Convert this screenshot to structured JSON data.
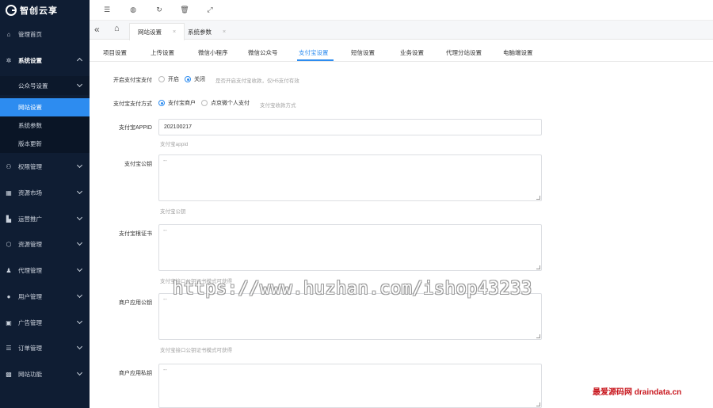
{
  "app": {
    "logo_text": "智创云享"
  },
  "sidebar": {
    "items": [
      {
        "label": "管理首页",
        "icon": "home-icon",
        "glyph": "⌂"
      },
      {
        "label": "系统设置",
        "icon": "gear-icon",
        "glyph": "✲"
      },
      {
        "label": "权限管理",
        "icon": "permission-icon",
        "glyph": "⚇"
      },
      {
        "label": "资源市场",
        "icon": "market-icon",
        "glyph": "▦"
      },
      {
        "label": "运营推广",
        "icon": "promotion-icon",
        "glyph": "▙"
      },
      {
        "label": "资源管理",
        "icon": "resource-icon",
        "glyph": "⬡"
      },
      {
        "label": "代理管理",
        "icon": "agent-icon",
        "glyph": "♟"
      },
      {
        "label": "用户管理",
        "icon": "user-icon",
        "glyph": "●"
      },
      {
        "label": "广告管理",
        "icon": "ad-icon",
        "glyph": "▣"
      },
      {
        "label": "订单管理",
        "icon": "order-icon",
        "glyph": "☰"
      },
      {
        "label": "网站功能",
        "icon": "site-function-icon",
        "glyph": "▩"
      }
    ],
    "subgroup": {
      "label": "公众号设置"
    },
    "subitems": [
      {
        "label": "网站设置"
      },
      {
        "label": "系统参数"
      },
      {
        "label": "版本更新"
      }
    ]
  },
  "toolbar": {
    "icons": [
      "collapse-icon",
      "globe-icon",
      "refresh-icon",
      "trash-icon",
      "fullscreen-icon"
    ],
    "glyphs": [
      "☰",
      "◍",
      "↻",
      "🗑",
      "⤢"
    ]
  },
  "tabs": {
    "back_glyph": "«",
    "home_glyph": "⌂",
    "close_glyph": "×",
    "items": [
      {
        "label": "网站设置"
      },
      {
        "label": "系统参数"
      }
    ]
  },
  "settings_tabs": [
    {
      "label": "项目设置"
    },
    {
      "label": "上传设置"
    },
    {
      "label": "微信小程序"
    },
    {
      "label": "微信公众号"
    },
    {
      "label": "支付宝设置"
    },
    {
      "label": "短信设置"
    },
    {
      "label": "业务设置"
    },
    {
      "label": "代理分站设置"
    },
    {
      "label": "电脑端设置"
    }
  ],
  "form": {
    "enable_alipay": {
      "label": "开启支付宝支付",
      "options": [
        "开启",
        "关闭"
      ],
      "selected": "关闭",
      "hint": "是否开启支付宝收款，仅H5支付有效"
    },
    "alipay_method": {
      "label": "支付宝支付方式",
      "options": [
        "支付宝商户",
        "点京微个人支付"
      ],
      "selected": "支付宝商户",
      "hint": "支付宝收款方式"
    },
    "appid": {
      "label": "支付宝APPID",
      "value": "202100217",
      "hint": "支付宝appid"
    },
    "public_key": {
      "label": "支付宝公钥",
      "value": "--",
      "hint": "支付宝公钥"
    },
    "root_cert": {
      "label": "支付宝根证书",
      "value": "--",
      "hint": "支付宝接口公钥证书模式可获得"
    },
    "app_public_key": {
      "label": "商户应用公钥",
      "value": "--",
      "hint": "支付宝接口公钥证书模式可获得"
    },
    "app_private_key": {
      "label": "商户应用私钥",
      "value": "--"
    }
  },
  "watermark": {
    "main": "https://www.huzhan.com/ishop43233",
    "corner": "最爱源码网 draindata.cn"
  },
  "colors": {
    "sidebar_bg": "#0f1d33",
    "accent": "#2d8cf0"
  }
}
